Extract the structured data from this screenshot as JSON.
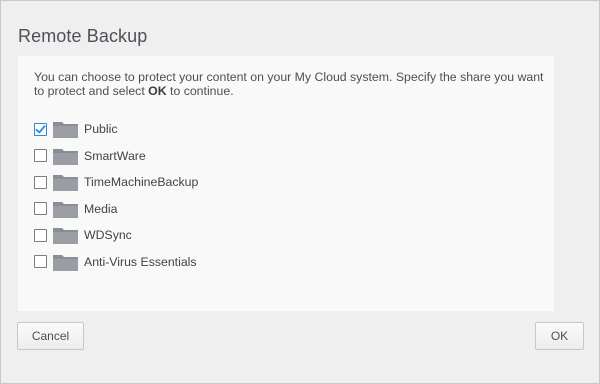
{
  "dialog": {
    "title": "Remote Backup",
    "description_pre": "You can choose to protect your content on your My Cloud system. Specify the share you want to protect and select ",
    "description_bold": "OK",
    "description_post": " to continue."
  },
  "shares": [
    {
      "label": "Public",
      "checked": true
    },
    {
      "label": "SmartWare",
      "checked": false
    },
    {
      "label": "TimeMachineBackup",
      "checked": false
    },
    {
      "label": "Media",
      "checked": false
    },
    {
      "label": "WDSync",
      "checked": false
    },
    {
      "label": "Anti-Virus Essentials",
      "checked": false
    }
  ],
  "buttons": {
    "cancel_label": "Cancel",
    "ok_label": "OK"
  },
  "icons": {
    "share": "folder-icon",
    "check": "checkmark-icon"
  },
  "colors": {
    "accent": "#2a8bd8",
    "folder": "#8a8e94"
  }
}
